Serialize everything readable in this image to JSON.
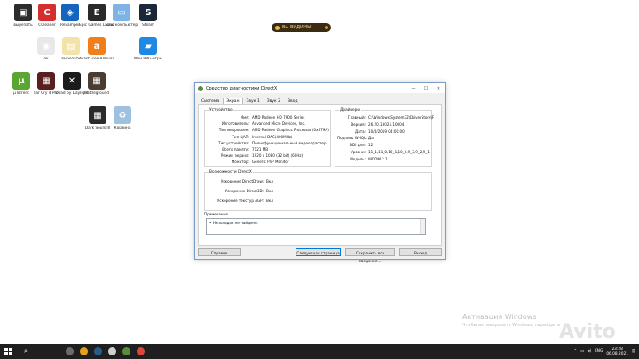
{
  "desktop": {
    "icons": [
      {
        "label": "вырезать",
        "icon": "bin-icon",
        "color": "#2c2c2c",
        "glyph": "▣"
      },
      {
        "label": "CCleaner",
        "icon": "ccleaner-icon",
        "color": "#d32f2f",
        "glyph": "C"
      },
      {
        "label": "Revamper",
        "icon": "lock-icon",
        "color": "#1565c0",
        "glyph": "◈"
      },
      {
        "label": "Epic Games Launcher",
        "icon": "epic-icon",
        "color": "#2a2a2a",
        "glyph": "E"
      },
      {
        "label": "Ваш компьютер",
        "icon": "computer-icon",
        "color": "#7fb2e5",
        "glyph": "▭"
      },
      {
        "label": "Steam",
        "icon": "steam-icon",
        "color": "#1b2838",
        "glyph": "S"
      },
      {
        "label": "ok",
        "icon": "chrome-icon",
        "color": "#e8e8e8",
        "glyph": "◉"
      },
      {
        "label": "вырезать",
        "icon": "archive-icon",
        "color": "#f2e3a8",
        "glyph": "▤"
      },
      {
        "label": "Avast Free Antivirus",
        "icon": "avast-icon",
        "color": "#f07f1b",
        "glyph": "a"
      },
      {
        "label": "Мои RPG-игры",
        "icon": "folder-icon",
        "color": "#1e88e5",
        "glyph": "▰"
      },
      {
        "label": "µTorrent",
        "icon": "utorrent-icon",
        "color": "#5ba632",
        "glyph": "µ"
      },
      {
        "label": "Far Cry 4 Pro",
        "icon": "farcry-icon",
        "color": "#5a2020",
        "glyph": "▦"
      },
      {
        "label": "Dead by Daylight",
        "icon": "dbd-icon",
        "color": "#1b1b1b",
        "glyph": "✕"
      },
      {
        "label": "Battleground",
        "icon": "game-icon",
        "color": "#4a3c30",
        "glyph": "▦"
      },
      {
        "label": "Dark Souls III",
        "icon": "darksouls-icon",
        "color": "#2b2b2b",
        "glyph": "▦"
      },
      {
        "label": "Корзина",
        "icon": "recycle-bin-icon",
        "color": "#9ec1e0",
        "glyph": "♻"
      }
    ]
  },
  "badge": {
    "label": "Вы ВИДИМЫ"
  },
  "window": {
    "title": "Средство диагностики DirectX",
    "controls": {
      "minimize": "—",
      "maximize": "☐",
      "close": "✕"
    },
    "tabs": [
      "Система",
      "Экран",
      "Звук 1",
      "Звук 2",
      "Ввод"
    ],
    "active_tab": 1,
    "device_group": {
      "title": "Устройство",
      "rows": [
        {
          "k": "Имя:",
          "v": "AMD Radeon HD 7900 Series"
        },
        {
          "k": "Изготовитель:",
          "v": "Advanced Micro Devices, Inc."
        },
        {
          "k": "Тип микросхем:",
          "v": "AMD Radeon Graphics Processor (0x679A)"
        },
        {
          "k": "Тип ЦАП:",
          "v": "Internal DAC(400MHz)"
        },
        {
          "k": "Тип устройства:",
          "v": "Полнофункциональный видеоадаптер"
        },
        {
          "k": "Всего памяти:",
          "v": "7121 MB"
        },
        {
          "k": "Режим экрана:",
          "v": "1920 x 1080 (32 bit) (60Hz)"
        },
        {
          "k": "Монитор:",
          "v": "Generic PnP Monitor"
        }
      ]
    },
    "drivers_group": {
      "title": "Драйверы",
      "rows": [
        {
          "k": "Главный:",
          "v": "C:\\Windows\\System32\\DriverStore\\F"
        },
        {
          "k": "Версия:",
          "v": "26.20.13025.10004"
        },
        {
          "k": "Дата:",
          "v": "10/4/2019 04:00:00"
        },
        {
          "k": "Подпись WHQL:",
          "v": "Да"
        },
        {
          "k": "DDI для:",
          "v": "12"
        },
        {
          "k": "Уровни:",
          "v": "11_1,11_0,10_1,10_0,9_3,9_2,9_1"
        },
        {
          "k": "Модель:",
          "v": "WDDM 2.1"
        }
      ]
    },
    "directx_group": {
      "title": "Возможности DirectX",
      "rows": [
        {
          "k": "Ускорение DirectDraw:",
          "v": "Вкл"
        },
        {
          "k": "Ускорение Direct3D:",
          "v": "Вкл"
        },
        {
          "k": "Ускорение текстур AGP:",
          "v": "Вкл"
        }
      ]
    },
    "notes": {
      "title": "Примечания",
      "items": [
        "Неполадок не найдено."
      ]
    },
    "buttons": {
      "help": "Справка",
      "next": "Следующая страница",
      "save": "Сохранить все сведения...",
      "exit": "Выход"
    }
  },
  "watermark": {
    "line1": "Активация Windows",
    "line2": "Чтобы активировать Windows, перейдите",
    "brand": "Avito"
  },
  "taskbar": {
    "apps": [
      {
        "icon": "task-view-icon",
        "color": "#6b6b6b"
      },
      {
        "icon": "chrome-taskbar-icon",
        "color": "#e3a21a"
      },
      {
        "icon": "steam-taskbar-icon",
        "color": "#2b5b8a"
      },
      {
        "icon": "epic-taskbar-icon",
        "color": "#cfcfcf"
      },
      {
        "icon": "dxdiag-taskbar-icon",
        "color": "#5b8a3c"
      },
      {
        "icon": "chrome2-taskbar-icon",
        "color": "#d9483b"
      }
    ],
    "language": "ENG",
    "time": "23:28",
    "date": "06.08.2021"
  }
}
